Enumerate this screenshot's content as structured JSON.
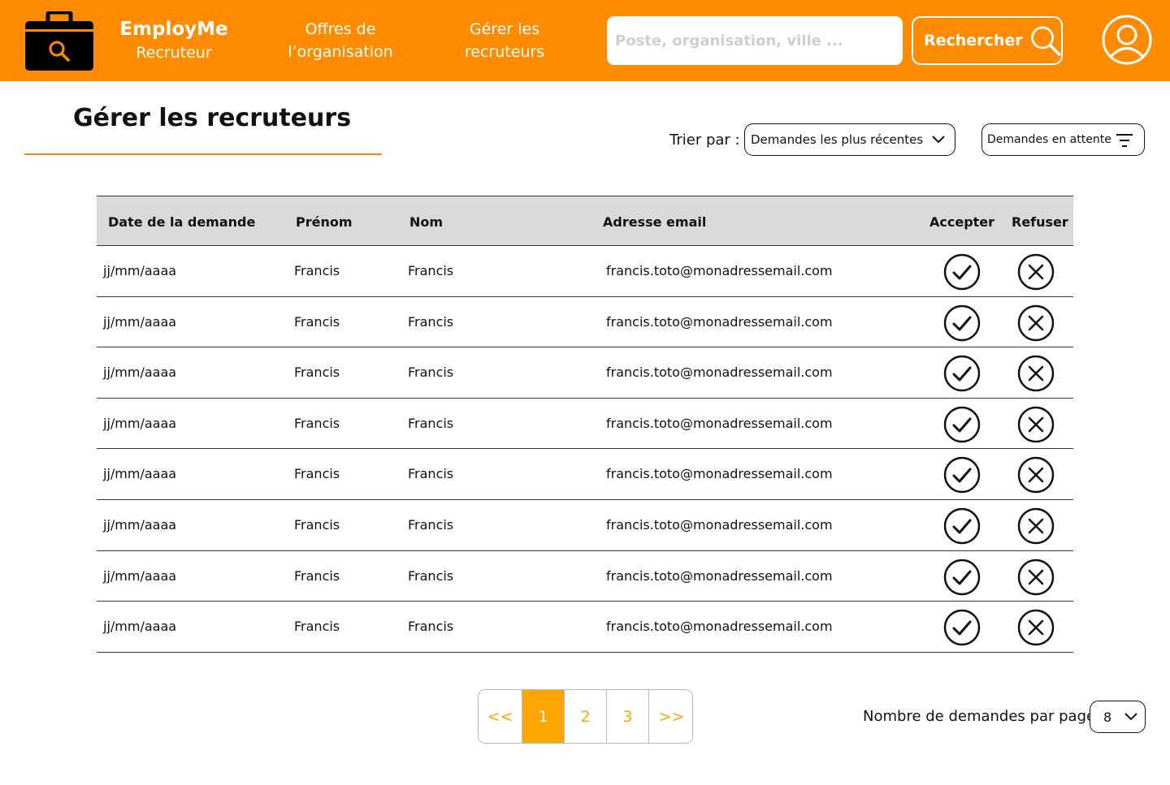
{
  "colors": {
    "brand": "#ff8c00",
    "accent_page": "#ffa500",
    "header_text": "#ffffff",
    "table_header_bg": "#d9d9d9"
  },
  "header": {
    "logo_icon": "briefcase-search-icon",
    "brand_name": "EmployMe",
    "brand_role": "Recruteur",
    "nav": [
      {
        "line1": "Offres de",
        "line2": "l’organisation"
      },
      {
        "line1": "Gérer les",
        "line2": "recruteurs"
      }
    ],
    "search": {
      "placeholder": "Poste, organisation, ville ...",
      "value": ""
    },
    "search_button_label": "Rechercher",
    "search_icon": "magnifier-icon",
    "profile_icon": "user-avatar-icon"
  },
  "page": {
    "title": "Gérer les recruteurs",
    "sort_label": "Trier par :",
    "sort_value": "Demandes les plus récentes",
    "filter_value": "Demandes en attente"
  },
  "table": {
    "columns": [
      "Date de la demande",
      "Prénom",
      "Nom",
      "Adresse email",
      "Accepter",
      "Refuser"
    ],
    "rows": [
      {
        "date": "jj/mm/aaaa",
        "first": "Francis",
        "last": "Francis",
        "email": "francis.toto@monadressemail.com"
      },
      {
        "date": "jj/mm/aaaa",
        "first": "Francis",
        "last": "Francis",
        "email": "francis.toto@monadressemail.com"
      },
      {
        "date": "jj/mm/aaaa",
        "first": "Francis",
        "last": "Francis",
        "email": "francis.toto@monadressemail.com"
      },
      {
        "date": "jj/mm/aaaa",
        "first": "Francis",
        "last": "Francis",
        "email": "francis.toto@monadressemail.com"
      },
      {
        "date": "jj/mm/aaaa",
        "first": "Francis",
        "last": "Francis",
        "email": "francis.toto@monadressemail.com"
      },
      {
        "date": "jj/mm/aaaa",
        "first": "Francis",
        "last": "Francis",
        "email": "francis.toto@monadressemail.com"
      },
      {
        "date": "jj/mm/aaaa",
        "first": "Francis",
        "last": "Francis",
        "email": "francis.toto@monadressemail.com"
      },
      {
        "date": "jj/mm/aaaa",
        "first": "Francis",
        "last": "Francis",
        "email": "francis.toto@monadressemail.com"
      }
    ],
    "accept_icon": "check-circle-icon",
    "refuse_icon": "x-circle-icon"
  },
  "pagination": {
    "first": "<<",
    "pages": [
      "1",
      "2",
      "3"
    ],
    "last": ">>",
    "current": "1",
    "per_page_label": "Nombre de demandes par page",
    "per_page_value": "8"
  }
}
